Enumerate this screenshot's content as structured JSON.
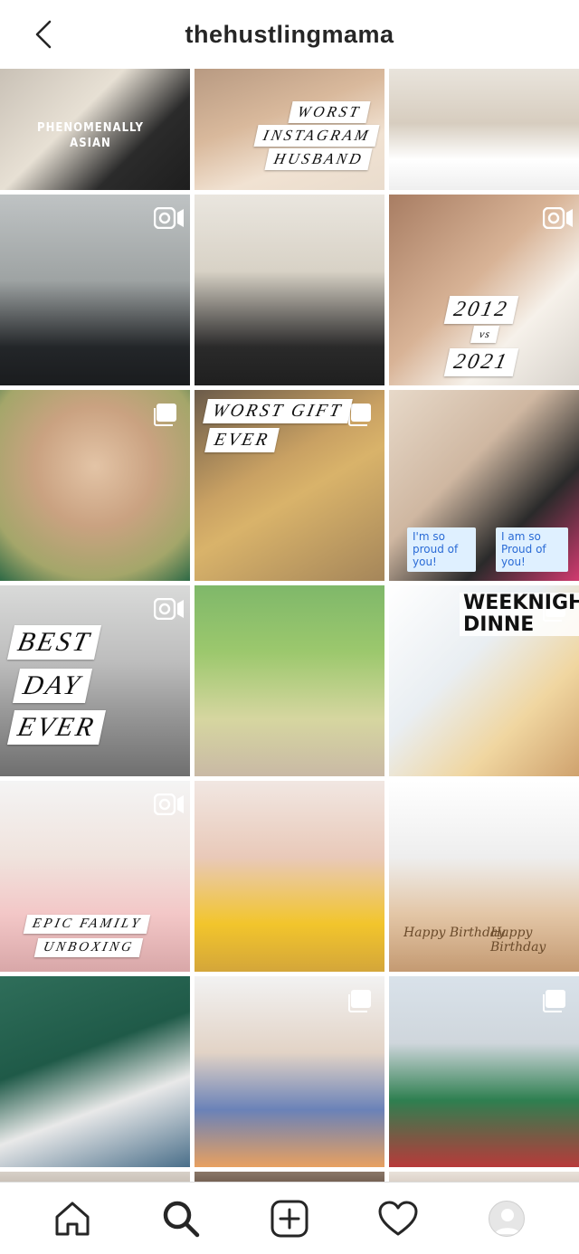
{
  "header": {
    "title": "thehustlingmama",
    "back_icon": "chevron-left-icon"
  },
  "posts": [
    {
      "bg": "linear-gradient(135deg,#c9c1b6 0%,#e7e0d4 40%,#2b2b2b 70%,#1e1e1e 100%)",
      "shirt": "PHENOMENALLY\nASIAN"
    },
    {
      "bg": "linear-gradient(160deg,#b89a82 0%,#d9b99c 40%,#f1e2d2 70%,#e9dccd 100%)",
      "lines": [
        "WORST",
        "INSTAGRAM",
        "HUSBAND"
      ]
    },
    {
      "bg": "linear-gradient(180deg,#e9e4dc 0%,#d7cdbf 45%,#ffffff 75%,#efefef 100%)"
    },
    {
      "bg": "linear-gradient(180deg,#bfc3c4 0%,#9ea3a3 45%,#232629 80%,#1a1c1e 100%)",
      "badge": "video"
    },
    {
      "bg": "linear-gradient(180deg,#eae6df 0%,#d8d2c6 40%,#2a2a2a 80%,#1f1f1f 100%)"
    },
    {
      "bg": "linear-gradient(135deg,#a87d63 0%,#d8b396 45%,#f6f1ea 70%,#d7d2cb 100%)",
      "badge": "video",
      "lines": [
        "2012",
        "vs",
        "2021"
      ]
    },
    {
      "bg": "radial-gradient(circle at 50% 40%,#e3c4a6 0%,#caa281 40%,#a4a66a 75%,#2e6a46 100%)",
      "badge": "multi"
    },
    {
      "bg": "linear-gradient(150deg,#6b5b4a 0%,#c9a163 40%,#d9b36a 55%,#a5865a 100%)",
      "badge": "multi",
      "lines": [
        "WORST GIFT",
        "EVER"
      ]
    },
    {
      "bg": "linear-gradient(135deg,#e7d9c9 0%,#cfb7a1 40%,#2a2a2a 70%,#d13a6f 100%)",
      "signs": [
        "I'm so proud of you!",
        "I am so Proud of you!"
      ]
    },
    {
      "bg": "linear-gradient(180deg,#d9dad9 0%,#bdbdbd 40%,#9a9a9a 65%,#6f6f6f 100%)",
      "badge": "video",
      "lines": [
        "BEST",
        "DAY",
        "EVER"
      ]
    },
    {
      "bg": "linear-gradient(180deg,#7fb86a 0%,#9cc86d 35%,#d6d6a0 70%,#c9b9a5 100%)"
    },
    {
      "bg": "linear-gradient(135deg,#ffffff 0%,#e9eef2 40%,#f0d6a0 70%,#cfa26e 100%)",
      "badge": "multi",
      "banner": "WEEKNIGHT\nDINNER"
    },
    {
      "bg": "linear-gradient(180deg,#f4f4f4 0%,#f0e3dd 40%,#f3c7c7 70%,#d8a7a8 100%)",
      "badge": "video",
      "lines": [
        "EPIC FAMILY",
        "UNBOXING"
      ]
    },
    {
      "bg": "linear-gradient(180deg,#f1e7e2 0%,#e9c9b9 40%,#f2c52c 75%,#d4a63a 100%)"
    },
    {
      "bg": "linear-gradient(180deg,#ffffff 0%,#eeeeee 40%,#e3c6a6 70%,#c49a72 100%)",
      "boxes": [
        "Happy Birthday",
        "Happy Birthday"
      ]
    },
    {
      "bg": "linear-gradient(160deg,#2f6e5a 0%,#1f5a48 40%,#e9e9e9 65%,#4a6f8a 100%)"
    },
    {
      "bg": "linear-gradient(180deg,#f2f2f2 0%,#e2d3c6 40%,#6a82b8 70%,#e8a060 100%)",
      "badge": "multi"
    },
    {
      "bg": "linear-gradient(180deg,#d9e2ea 0%,#cfd6dc 35%,#2e7f50 65%,#b83a3a 100%)",
      "badge": "multi"
    },
    {
      "bg": "linear-gradient(180deg,#d7d0c8 0%,#bdb3a8 100%)"
    },
    {
      "bg": "linear-gradient(180deg,#8a7768 0%,#5f4c40 100%)"
    },
    {
      "bg": "linear-gradient(180deg,#e9e1da 0%,#cfc3b7 100%)"
    }
  ],
  "nav": {
    "items": [
      {
        "name": "home-icon"
      },
      {
        "name": "search-icon"
      },
      {
        "name": "new-post-icon"
      },
      {
        "name": "heart-icon"
      },
      {
        "name": "profile-avatar"
      }
    ]
  },
  "colors": {
    "text_primary": "#262626",
    "divider": "#dbdbdb"
  }
}
